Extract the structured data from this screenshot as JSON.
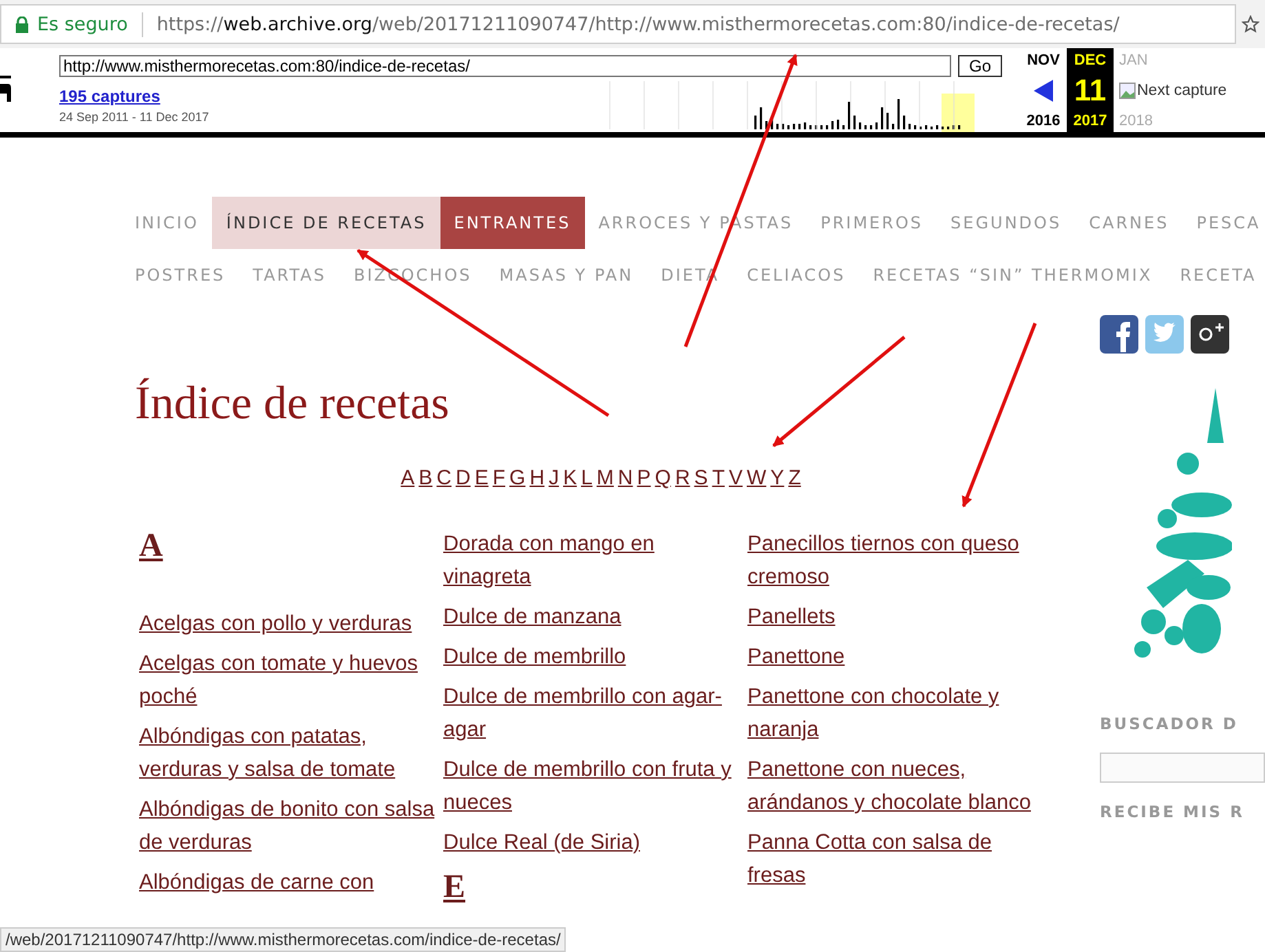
{
  "browser": {
    "secure_label": "Es seguro",
    "url": {
      "scheme": "https://",
      "host": "web.archive.org",
      "path": "/web/20171211090747/http://www.misthermorecetas.com:80/indice-de-recetas/"
    }
  },
  "wayback": {
    "url_value": "http://www.misthermorecetas.com:80/indice-de-recetas/",
    "go_label": "Go",
    "captures": "195 captures",
    "range": "24 Sep 2011 - 11 Dec 2017",
    "months": [
      {
        "kind": "prev",
        "month": "NOV",
        "year": "2016",
        "selected": false,
        "disabled": false
      },
      {
        "kind": "current",
        "month": "DEC",
        "day": "11",
        "year": "2017",
        "selected": true,
        "disabled": false
      },
      {
        "kind": "next",
        "month": "JAN",
        "year": "2018",
        "next_label": "Next capture",
        "selected": false,
        "disabled": true
      }
    ]
  },
  "nav": [
    [
      {
        "label": "INICIO",
        "selected": false,
        "highlighted": false
      },
      {
        "label": "ÍNDICE DE RECETAS",
        "selected": false,
        "highlighted": true
      },
      {
        "label": "ENTRANTES",
        "selected": true,
        "highlighted": false
      },
      {
        "label": "ARROCES Y PASTAS",
        "selected": false,
        "highlighted": false
      },
      {
        "label": "PRIMEROS",
        "selected": false,
        "highlighted": false
      },
      {
        "label": "SEGUNDOS",
        "selected": false,
        "highlighted": false
      },
      {
        "label": "CARNES",
        "selected": false,
        "highlighted": false
      },
      {
        "label": "PESCA",
        "selected": false,
        "highlighted": false
      }
    ],
    [
      {
        "label": "POSTRES",
        "selected": false,
        "highlighted": false
      },
      {
        "label": "TARTAS",
        "selected": false,
        "highlighted": false
      },
      {
        "label": "BIZCOCHOS",
        "selected": false,
        "highlighted": false
      },
      {
        "label": "MASAS Y PAN",
        "selected": false,
        "highlighted": false
      },
      {
        "label": "DIETA",
        "selected": false,
        "highlighted": false
      },
      {
        "label": "CELIACOS",
        "selected": false,
        "highlighted": false
      },
      {
        "label": "RECETAS “SIN” THERMOMIX",
        "selected": false,
        "highlighted": false
      },
      {
        "label": "RECETA",
        "selected": false,
        "highlighted": false
      }
    ]
  ],
  "title": "Índice de recetas",
  "letters": [
    "A",
    "B",
    "C",
    "D",
    "E",
    "F",
    "G",
    "H",
    "J",
    "K",
    "L",
    "M",
    "N",
    "P",
    "Q",
    "R",
    "S",
    "T",
    "V",
    "W",
    "Y",
    "Z"
  ],
  "columns": [
    [
      {
        "kind": "heading",
        "text": "A"
      },
      {
        "kind": "link",
        "text": "Acelgas con pollo y verduras"
      },
      {
        "kind": "link",
        "text": "Acelgas con tomate y huevos poché"
      },
      {
        "kind": "link",
        "text": "Albóndigas con patatas, verduras y salsa de tomate"
      },
      {
        "kind": "link",
        "text": "Albóndigas de bonito con salsa de verduras"
      },
      {
        "kind": "link",
        "text": "Albóndigas de carne con"
      }
    ],
    [
      {
        "kind": "link",
        "text": "Dorada con mango en vinagreta"
      },
      {
        "kind": "link",
        "text": "Dulce de manzana"
      },
      {
        "kind": "link",
        "text": "Dulce de membrillo"
      },
      {
        "kind": "link",
        "text": "Dulce de membrillo con agar-agar"
      },
      {
        "kind": "link",
        "text": "Dulce de membrillo con fruta y nueces"
      },
      {
        "kind": "link",
        "text": "Dulce Real (de Siria)"
      },
      {
        "kind": "heading",
        "text": "E"
      }
    ],
    [
      {
        "kind": "link",
        "text": "Panecillos tiernos con queso cremoso"
      },
      {
        "kind": "link",
        "text": "Panellets"
      },
      {
        "kind": "link",
        "text": "Panettone"
      },
      {
        "kind": "link",
        "text": "Panettone con chocolate y naranja"
      },
      {
        "kind": "link",
        "text": "Panettone con nueces, arándanos y chocolate blanco"
      },
      {
        "kind": "link",
        "text": "Panna Cotta con salsa de fresas"
      }
    ]
  ],
  "sidebar": {
    "social": [
      {
        "kind": "facebook"
      },
      {
        "kind": "twitter"
      },
      {
        "kind": "googleplus"
      }
    ],
    "search_heading": "BUSCADOR D",
    "subscribe_heading": "RECIBE MIS R"
  },
  "status_bar": "/web/20171211090747/http://www.misthermorecetas.com/indice-de-recetas/"
}
